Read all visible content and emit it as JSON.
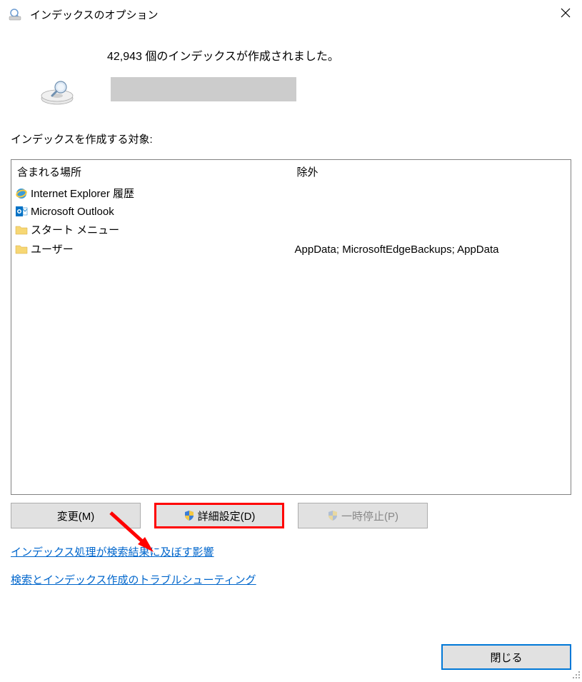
{
  "window": {
    "title": "インデックスのオプション"
  },
  "status": {
    "count_text": "42,943 個のインデックスが作成されました。"
  },
  "target_label": "インデックスを作成する対象:",
  "table": {
    "col_included": "含まれる場所",
    "col_excluded": "除外",
    "rows": [
      {
        "icon": "ie",
        "label": "Internet Explorer 履歴",
        "excluded": ""
      },
      {
        "icon": "outlook",
        "label": "Microsoft Outlook",
        "excluded": ""
      },
      {
        "icon": "folder",
        "label": "スタート メニュー",
        "excluded": ""
      },
      {
        "icon": "folder",
        "label": "ユーザー",
        "excluded": "AppData; MicrosoftEdgeBackups; AppData"
      }
    ]
  },
  "buttons": {
    "modify": "変更(M)",
    "advanced": "詳細設定(D)",
    "pause": "一時停止(P)",
    "close": "閉じる"
  },
  "links": {
    "effect": "インデックス処理が検索結果に及ぼす影響",
    "troubleshoot": "検索とインデックス作成のトラブルシューティング"
  }
}
